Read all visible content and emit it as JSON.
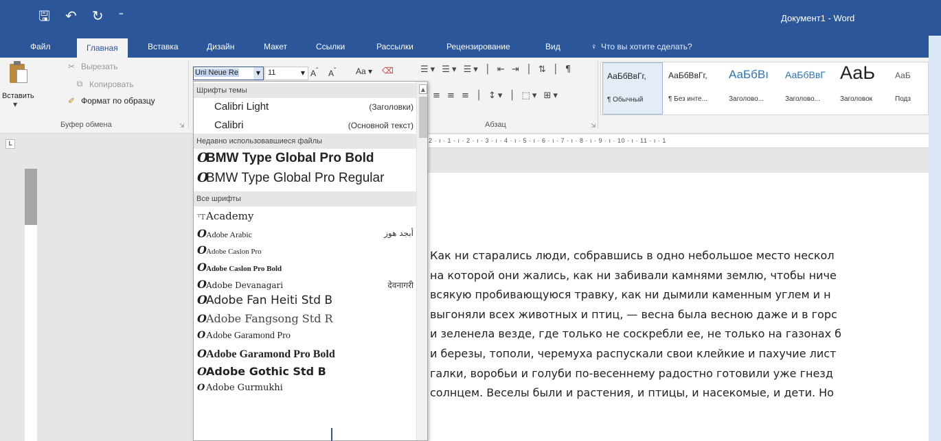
{
  "window": {
    "title": "Документ1 - Word"
  },
  "quick_access": {
    "save_icon": "save-icon",
    "undo_icon": "undo-icon",
    "redo_icon": "redo-icon",
    "customize_icon": "customize-icon"
  },
  "tabs": [
    {
      "label": "Файл"
    },
    {
      "label": "Главная"
    },
    {
      "label": "Вставка"
    },
    {
      "label": "Дизайн"
    },
    {
      "label": "Макет"
    },
    {
      "label": "Ссылки"
    },
    {
      "label": "Рассылки"
    },
    {
      "label": "Рецензирование"
    },
    {
      "label": "Вид"
    }
  ],
  "tell_me": {
    "placeholder": "Что вы хотите сделать?"
  },
  "clipboard": {
    "paste": "Вставить",
    "cut": "Вырезать",
    "copy": "Копировать",
    "format_painter": "Формат по образцу",
    "group_label": "Буфер обмена"
  },
  "font": {
    "name": "Uni Neue Re",
    "size": "11",
    "grow": "A",
    "shrink": "A",
    "case": "Aa"
  },
  "paragraph": {
    "group_label": "Абзац"
  },
  "styles": [
    {
      "sample": "АаБбВвГг,",
      "name": "¶ Обычный"
    },
    {
      "sample": "АаБбВвГг,",
      "name": "¶ Без инте..."
    },
    {
      "sample": "АаБбВı",
      "name": "Заголово..."
    },
    {
      "sample": "АаБбВвГ",
      "name": "Заголово..."
    },
    {
      "sample": "АаЬ",
      "name": "Заголовок"
    },
    {
      "sample": "АаБ",
      "name": "Подз"
    }
  ],
  "ruler": {
    "scale": "2 · ı · 1 · ı · 2 · ı · 3 · ı · 4 · ı · 5 · ı · 6 · ı · 7 · ı · 8 · ı · 9 · ı · 10 · ı · 11 · ı · 1"
  },
  "font_dropdown": {
    "theme_header": "Шрифты темы",
    "theme_fonts": [
      {
        "name": "Calibri Light",
        "hint": "(Заголовки)"
      },
      {
        "name": "Calibri",
        "hint": "(Основной текст)"
      }
    ],
    "recent_header": "Недавно использовавшиеся файлы",
    "recent_fonts": [
      {
        "name": "BMW Type Global Pro Bold"
      },
      {
        "name": "BMW Type Global Pro Regular"
      }
    ],
    "all_header": "Все шрифты",
    "all_fonts": [
      {
        "name": "Academy",
        "hint": ""
      },
      {
        "name": "Adobe Arabic",
        "hint": "أبجد هوز"
      },
      {
        "name": "Adobe Caslon Pro",
        "hint": ""
      },
      {
        "name": "Adobe Caslon Pro Bold",
        "hint": ""
      },
      {
        "name": "Adobe Devanagari",
        "hint": "देवनागरी"
      },
      {
        "name": "Adobe Fan Heiti Std B",
        "hint": ""
      },
      {
        "name": "Adobe Fangsong Std R",
        "hint": ""
      },
      {
        "name": "Adobe Garamond Pro",
        "hint": ""
      },
      {
        "name": "Adobe Garamond Pro Bold",
        "hint": ""
      },
      {
        "name": "Adobe Gothic Std B",
        "hint": ""
      },
      {
        "name": "Adobe Gurmukhi",
        "hint": ""
      }
    ]
  },
  "document": {
    "lines": [
      "Как ни старались люди, собравшись в одно небольшое место нескол",
      "на которой они жались, как ни забивали камнями землю, чтобы ниче",
      "всякую пробивающуюся травку, как ни дымили каменным углем и н",
      "выгоняли всех животных и птиц, — весна была весною даже и в горс",
      "и зеленела везде, где только не соскребли ее, не только на газонах б",
      "и березы, тополи, черемуха распускали свои клейкие и пахучие лист",
      "галки, воробьи и голуби по-весеннему радостно готовили уже гнезд",
      "солнцем. Веселы были и растения, и птицы, и насекомые, и дети. Но"
    ]
  }
}
